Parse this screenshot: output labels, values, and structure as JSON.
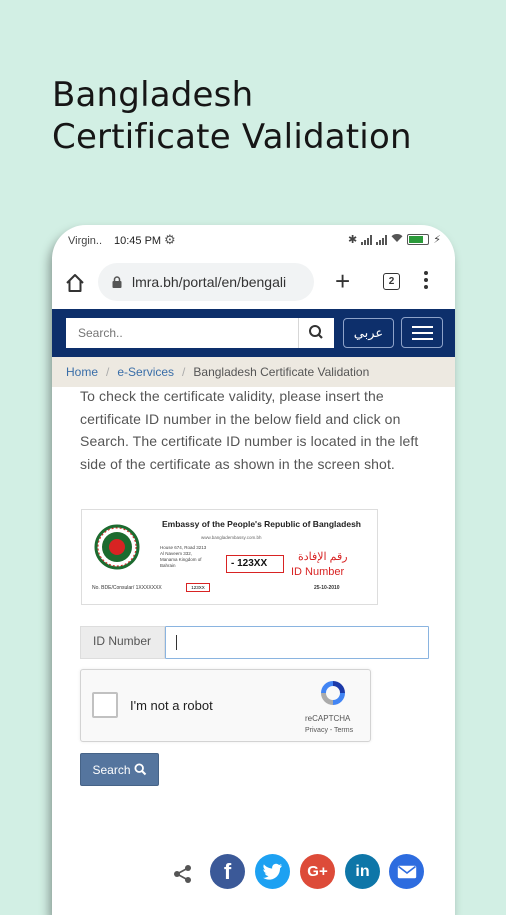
{
  "headline": {
    "line1": "Bangladesh",
    "line2": "Certificate Validation"
  },
  "status_bar": {
    "carrier": "Virgin..",
    "time": "10:45 PM"
  },
  "browser": {
    "url": "lmra.bh/portal/en/bengali",
    "tab_count": "2"
  },
  "navbar": {
    "search_placeholder": "Search..",
    "language_button": "عربي"
  },
  "breadcrumb": {
    "home": "Home",
    "eservices": "e-Services",
    "current": "Bangladesh Certificate Validation"
  },
  "content": {
    "intro": "To check the certificate validity, please insert the certificate ID number in the below field and click on Search. The certificate ID number is located in the left side of the certificate as shown in the screen shot.",
    "certificate": {
      "title": "Embassy of the People's Republic of Bangladesh",
      "url": "www.bangladembassy.com.bh",
      "address": "House 674, Road 3213 Al Naveem 332, Manama Kingdom of Bahrain",
      "id_sample": "- 123XX",
      "arabic_label": "رقم الإفادة",
      "id_label": "ID Number",
      "date": "25-10-2010",
      "ref": "No. BDE/Consular/ 1XXXXXXX",
      "small_id": "123XX"
    },
    "form": {
      "id_label": "ID Number",
      "id_value": "",
      "recaptcha_label": "I'm not a robot",
      "recaptcha_brand": "reCAPTCHA",
      "recaptcha_terms": "Privacy - Terms",
      "search_button": "Search"
    }
  },
  "colors": {
    "background": "#d2efe4",
    "navbar": "#0d2f6b",
    "search_button": "#55759e",
    "facebook": "#3b5998",
    "twitter": "#1da1f2",
    "google_plus": "#dd4b39",
    "linkedin": "#0e76a8",
    "email": "#2d6cdf"
  },
  "share_icons": [
    "share-icon",
    "facebook-icon",
    "twitter-icon",
    "google-plus-icon",
    "linkedin-icon",
    "email-icon"
  ]
}
